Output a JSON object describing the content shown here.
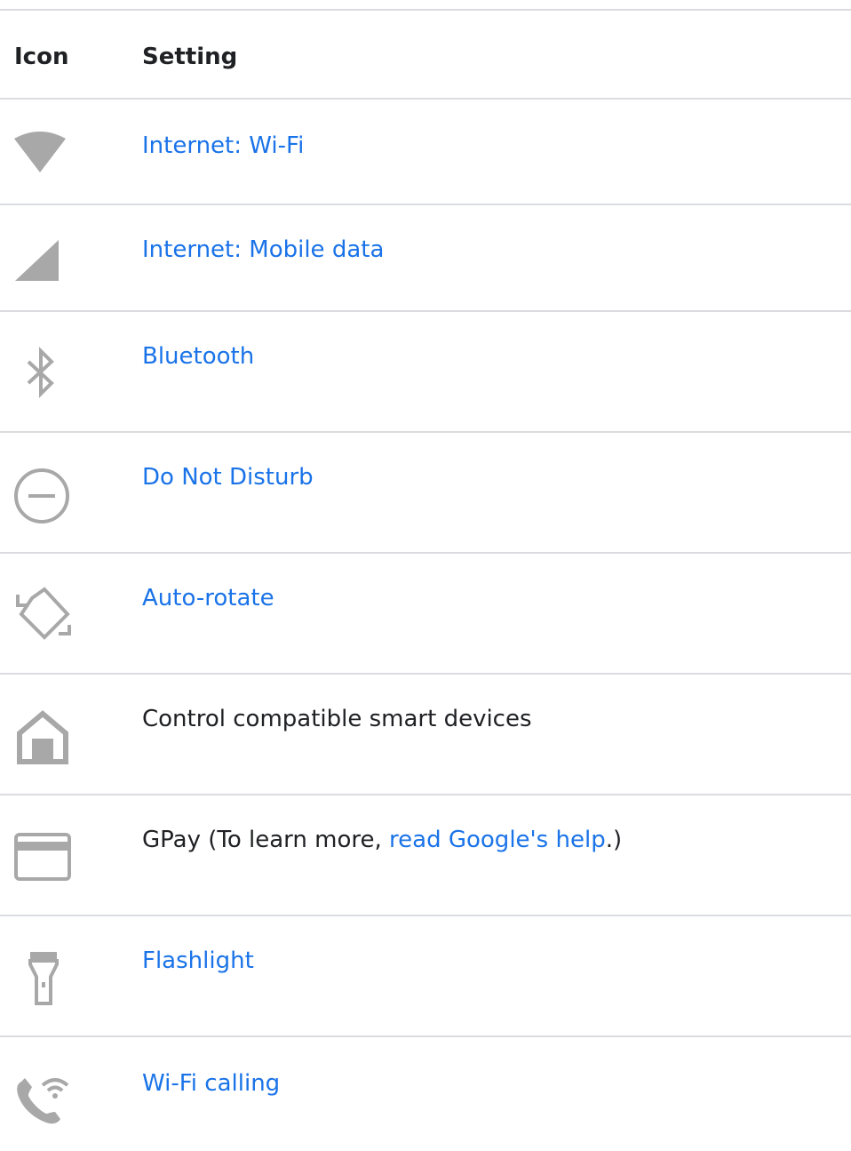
{
  "table": {
    "headers": {
      "icon": "Icon",
      "setting": "Setting"
    },
    "rows": [
      {
        "icon": "wifi-icon",
        "label": "Internet: Wi-Fi",
        "is_link": true
      },
      {
        "icon": "mobile-data-icon",
        "label": "Internet: Mobile data",
        "is_link": true
      },
      {
        "icon": "bluetooth-icon",
        "label": "Bluetooth",
        "is_link": true
      },
      {
        "icon": "do-not-disturb-icon",
        "label": "Do Not Disturb",
        "is_link": true
      },
      {
        "icon": "auto-rotate-icon",
        "label": "Auto-rotate",
        "is_link": true
      },
      {
        "icon": "home-icon",
        "label": "Control compatible smart devices",
        "is_link": false
      },
      {
        "icon": "credit-card-icon",
        "label_prefix": "GPay (To learn more, ",
        "link_text": "read Google's help",
        "label_suffix": ".)"
      },
      {
        "icon": "flashlight-icon",
        "label": "Flashlight",
        "is_link": true
      },
      {
        "icon": "wifi-calling-icon",
        "label": "Wi-Fi calling",
        "is_link": true
      }
    ]
  },
  "colors": {
    "link": "#1a73e8",
    "text": "#202124",
    "icon_gray": "#a8a8a8",
    "divider": "#dadce0"
  }
}
